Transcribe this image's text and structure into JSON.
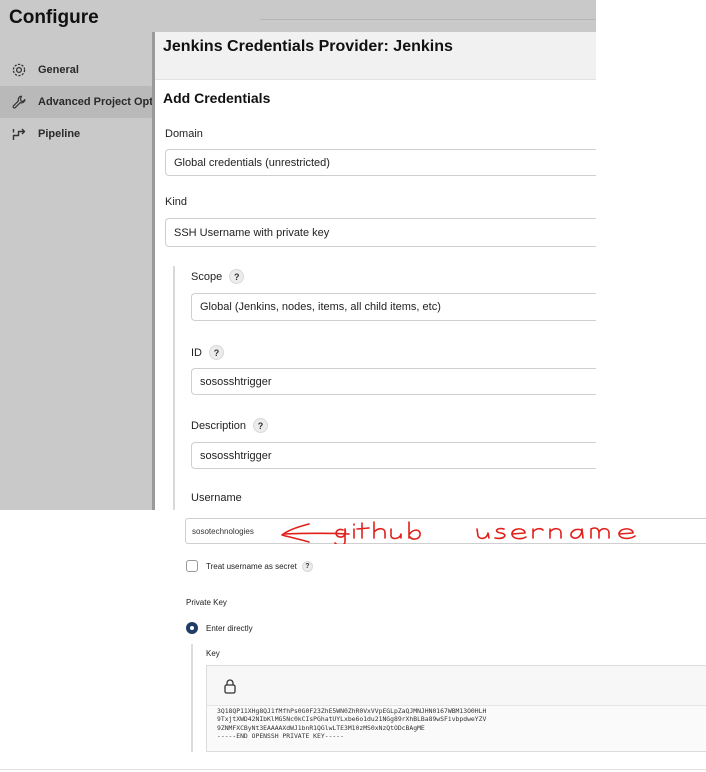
{
  "page": {
    "title": "Configure"
  },
  "sidebar": {
    "items": [
      {
        "label": "General",
        "icon": "gear-icon"
      },
      {
        "label": "Advanced Project Opt",
        "icon": "wrench-icon"
      },
      {
        "label": "Pipeline",
        "icon": "pipeline-icon"
      }
    ]
  },
  "dialog": {
    "title": "Jenkins Credentials Provider: Jenkins",
    "section_title": "Add Credentials",
    "help_glyph": "?",
    "domain": {
      "label": "Domain",
      "value": "Global credentials (unrestricted)"
    },
    "kind": {
      "label": "Kind",
      "value": "SSH Username with private key"
    },
    "scope": {
      "label": "Scope",
      "value": "Global (Jenkins, nodes, items, all child items, etc)"
    },
    "id": {
      "label": "ID",
      "value": "sososshtrigger"
    },
    "description": {
      "label": "Description",
      "value": "sososshtrigger"
    },
    "username": {
      "label": "Username"
    }
  },
  "bottom": {
    "username_value": "sosotechnologies",
    "annotation": "github username",
    "treat_secret_label": "Treat username as secret",
    "private_key_label": "Private Key",
    "enter_directly_label": "Enter directly",
    "key_label": "Key",
    "key_lines": [
      "3Q18QP11XHg8QJ1fMfhPs0G0F23ZhE5WN0ZhR0VxVVpEGLpZaQJMNJHN0167WBM13O0HLH",
      "9TxjtXWD42NIbKlMG5Nc0kCIsPGhatUYLxbe6o1du21NGg89rXhBLBa89wSFivbpdweYZV",
      "9ZNMFXCByNt3EAAAAXdWJ1bnR1QGlwLTE3M10zMS0xNzQtODcBAgME",
      "-----END OPENSSH PRIVATE KEY-----",
      ""
    ]
  },
  "colors": {
    "overlay_gray": "#c9c9c9",
    "radio_selected": "#1f3d66",
    "annotation_red": "#e0201a"
  }
}
